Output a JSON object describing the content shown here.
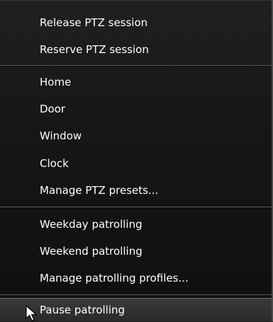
{
  "menu": {
    "group_session": [
      {
        "label": "Release PTZ session"
      },
      {
        "label": "Reserve PTZ session"
      }
    ],
    "group_presets": [
      {
        "label": "Home"
      },
      {
        "label": "Door"
      },
      {
        "label": "Window"
      },
      {
        "label": "Clock"
      },
      {
        "label": "Manage PTZ presets..."
      }
    ],
    "group_patrolling": [
      {
        "label": "Weekday patrolling"
      },
      {
        "label": "Weekend patrolling"
      },
      {
        "label": "Manage patrolling profiles..."
      }
    ],
    "group_pause": [
      {
        "label": "Pause patrolling"
      }
    ]
  },
  "cursor_icon": "mouse-pointer-icon"
}
